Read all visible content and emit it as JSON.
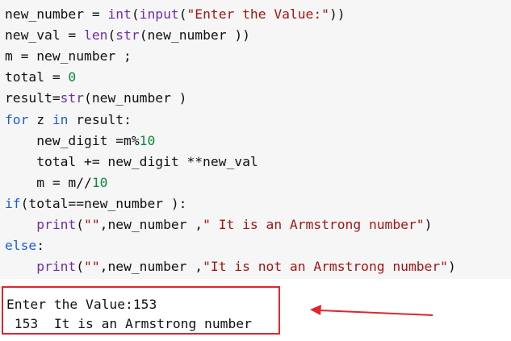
{
  "colors": {
    "code_bg": "#f6f6f6",
    "default_text": "#111111",
    "function": "#6f2ea3",
    "string": "#a31515",
    "number": "#0b8a3c",
    "keyword": "#1d5fd1",
    "highlight": "#e0252b"
  },
  "code": {
    "lines": [
      [
        {
          "text": "new_number = ",
          "type": "plain"
        },
        {
          "text": "int",
          "type": "func"
        },
        {
          "text": "(",
          "type": "plain"
        },
        {
          "text": "input",
          "type": "func"
        },
        {
          "text": "(",
          "type": "plain"
        },
        {
          "text": "\"Enter the Value:\"",
          "type": "str"
        },
        {
          "text": "))",
          "type": "plain"
        }
      ],
      [
        {
          "text": "new_val = ",
          "type": "plain"
        },
        {
          "text": "len",
          "type": "func"
        },
        {
          "text": "(",
          "type": "plain"
        },
        {
          "text": "str",
          "type": "func"
        },
        {
          "text": "(new_number ))",
          "type": "plain"
        }
      ],
      [
        {
          "text": "m = new_number ;",
          "type": "plain"
        }
      ],
      [
        {
          "text": "total = ",
          "type": "plain"
        },
        {
          "text": "0",
          "type": "num"
        }
      ],
      [
        {
          "text": "result=",
          "type": "plain"
        },
        {
          "text": "str",
          "type": "func"
        },
        {
          "text": "(new_number )",
          "type": "plain"
        }
      ],
      [
        {
          "text": "for",
          "type": "kw"
        },
        {
          "text": " z ",
          "type": "plain"
        },
        {
          "text": "in",
          "type": "kw"
        },
        {
          "text": " result:",
          "type": "plain"
        }
      ],
      [
        {
          "text": "    new_digit =m%",
          "type": "plain"
        },
        {
          "text": "10",
          "type": "num"
        }
      ],
      [
        {
          "text": "    total += new_digit **new_val",
          "type": "plain"
        }
      ],
      [
        {
          "text": "    m = m//",
          "type": "plain"
        },
        {
          "text": "10",
          "type": "num"
        }
      ],
      [
        {
          "text": "if",
          "type": "kw"
        },
        {
          "text": "(total==new_number ):",
          "type": "plain"
        }
      ],
      [
        {
          "text": "    ",
          "type": "plain"
        },
        {
          "text": "print",
          "type": "func"
        },
        {
          "text": "(",
          "type": "plain"
        },
        {
          "text": "\"\"",
          "type": "str"
        },
        {
          "text": ",new_number ,",
          "type": "plain"
        },
        {
          "text": "\" It is an Armstrong number\"",
          "type": "str"
        },
        {
          "text": ")",
          "type": "plain"
        }
      ],
      [
        {
          "text": "else",
          "type": "kw"
        },
        {
          "text": ":",
          "type": "plain"
        }
      ],
      [
        {
          "text": "    ",
          "type": "plain"
        },
        {
          "text": "print",
          "type": "func"
        },
        {
          "text": "(",
          "type": "plain"
        },
        {
          "text": "\"\"",
          "type": "str"
        },
        {
          "text": ",new_number ,",
          "type": "plain"
        },
        {
          "text": "\"It is not an Armstrong number\"",
          "type": "str"
        },
        {
          "text": ")",
          "type": "plain"
        }
      ]
    ]
  },
  "output": {
    "lines": [
      "Enter the Value:153",
      " 153  It is an Armstrong number"
    ]
  },
  "annotation": {
    "arrow_icon": "left-arrow-icon",
    "arrow_color": "#e0252b"
  }
}
